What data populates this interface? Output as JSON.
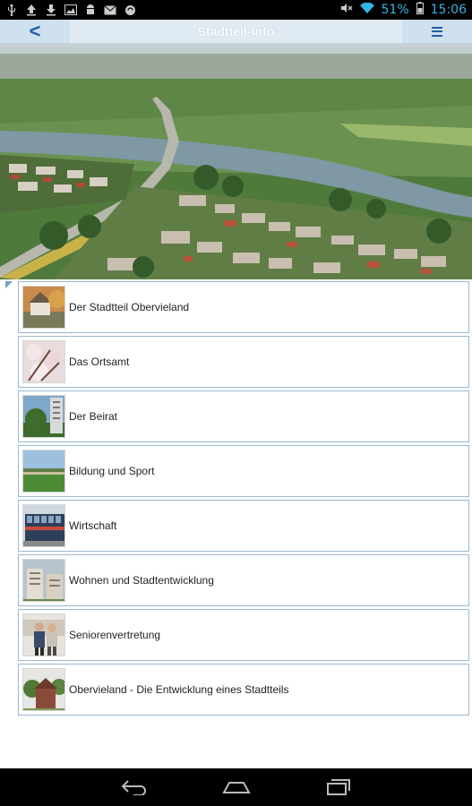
{
  "status_bar": {
    "battery_percent": "51%",
    "time": "15:06",
    "icons_left": [
      "usb-icon",
      "upload-icon",
      "download-icon",
      "image-icon",
      "android-icon",
      "mail-icon",
      "sync-icon"
    ],
    "icons_right": [
      "mute-icon",
      "wifi-icon",
      "battery-icon"
    ]
  },
  "app_bar": {
    "back_label": "<",
    "title": "Stadtteil-Info",
    "menu_icon": "hamburger-menu-icon"
  },
  "list": {
    "items": [
      {
        "label": "Der Stadtteil Obervieland",
        "thumb": "houses-autumn"
      },
      {
        "label": "Das Ortsamt",
        "thumb": "cherry-blossoms"
      },
      {
        "label": "Der Beirat",
        "thumb": "tower-building"
      },
      {
        "label": "Bildung und Sport",
        "thumb": "sports-field"
      },
      {
        "label": "Wirtschaft",
        "thumb": "office-facade"
      },
      {
        "label": "Wohnen und Stadtentwicklung",
        "thumb": "apartment-blocks"
      },
      {
        "label": "Seniorenvertretung",
        "thumb": "two-people"
      },
      {
        "label": "Obervieland - Die Entwicklung eines Stadtteils",
        "thumb": "old-building"
      }
    ]
  },
  "nav_bar": {
    "buttons": [
      "back-icon",
      "home-icon",
      "recent-apps-icon"
    ]
  },
  "colors": {
    "accent": "#1f5fa6",
    "app_bar": "#cfe0ee",
    "border": "#9cb7d0",
    "status_highlight": "#34b5e5"
  }
}
